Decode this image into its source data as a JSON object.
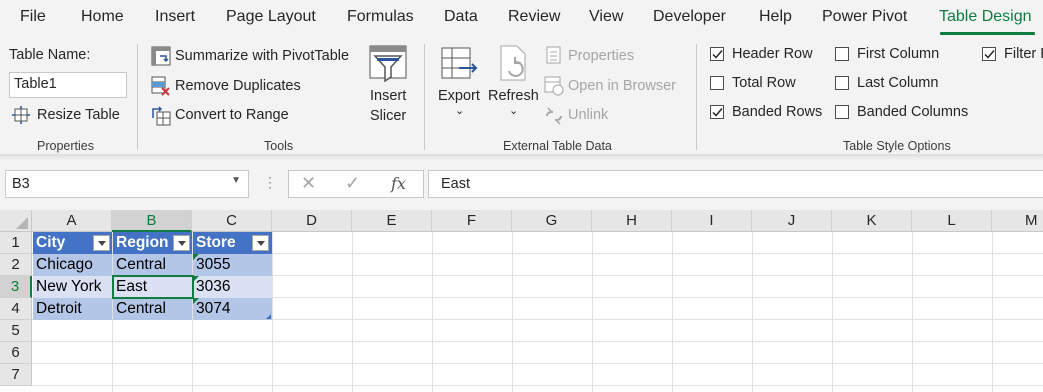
{
  "menu": {
    "tabs": [
      "File",
      "Home",
      "Insert",
      "Page Layout",
      "Formulas",
      "Data",
      "Review",
      "View",
      "Developer",
      "Help",
      "Power Pivot",
      "Table Design"
    ],
    "active_tab": "Table Design"
  },
  "ribbon": {
    "properties": {
      "table_name_label": "Table Name:",
      "table_name_value": "Table1",
      "resize_table": "Resize Table",
      "group_label": "Properties"
    },
    "tools": {
      "summarize_pivot": "Summarize with PivotTable",
      "remove_duplicates": "Remove Duplicates",
      "convert_to_range": "Convert to Range",
      "insert_slicer_line1": "Insert",
      "insert_slicer_line2": "Slicer",
      "group_label": "Tools"
    },
    "external": {
      "export": "Export",
      "refresh": "Refresh",
      "properties": "Properties",
      "open_in_browser": "Open in Browser",
      "unlink": "Unlink",
      "group_label": "External Table Data"
    },
    "style_options": {
      "header_row": {
        "label": "Header Row",
        "checked": true
      },
      "total_row": {
        "label": "Total Row",
        "checked": false
      },
      "banded_rows": {
        "label": "Banded Rows",
        "checked": true
      },
      "first_column": {
        "label": "First Column",
        "checked": false
      },
      "last_column": {
        "label": "Last Column",
        "checked": false
      },
      "banded_columns": {
        "label": "Banded Columns",
        "checked": false
      },
      "filter_button": {
        "label": "Filter B",
        "checked": true
      },
      "group_label": "Table Style Options"
    }
  },
  "formula_bar": {
    "name_box": "B3",
    "formula_value": "East",
    "fx_label": "fx"
  },
  "sheet": {
    "columns": [
      "A",
      "B",
      "C",
      "D",
      "E",
      "F",
      "G",
      "H",
      "I",
      "J",
      "K",
      "L",
      "M"
    ],
    "rows": [
      "1",
      "2",
      "3",
      "4",
      "5",
      "6",
      "7"
    ],
    "selected_column": "B",
    "selected_row": "3",
    "table": {
      "headers": [
        "City",
        "Region",
        "Store"
      ],
      "rows": [
        [
          "Chicago",
          "Central",
          "3055"
        ],
        [
          "New York",
          "East",
          "3036"
        ],
        [
          "Detroit",
          "Central",
          "3074"
        ]
      ]
    }
  },
  "colors": {
    "accent": "#107c41",
    "table_header": "#4472c4",
    "band_dark": "#b4c6e7",
    "band_light": "#d9e1f2"
  }
}
